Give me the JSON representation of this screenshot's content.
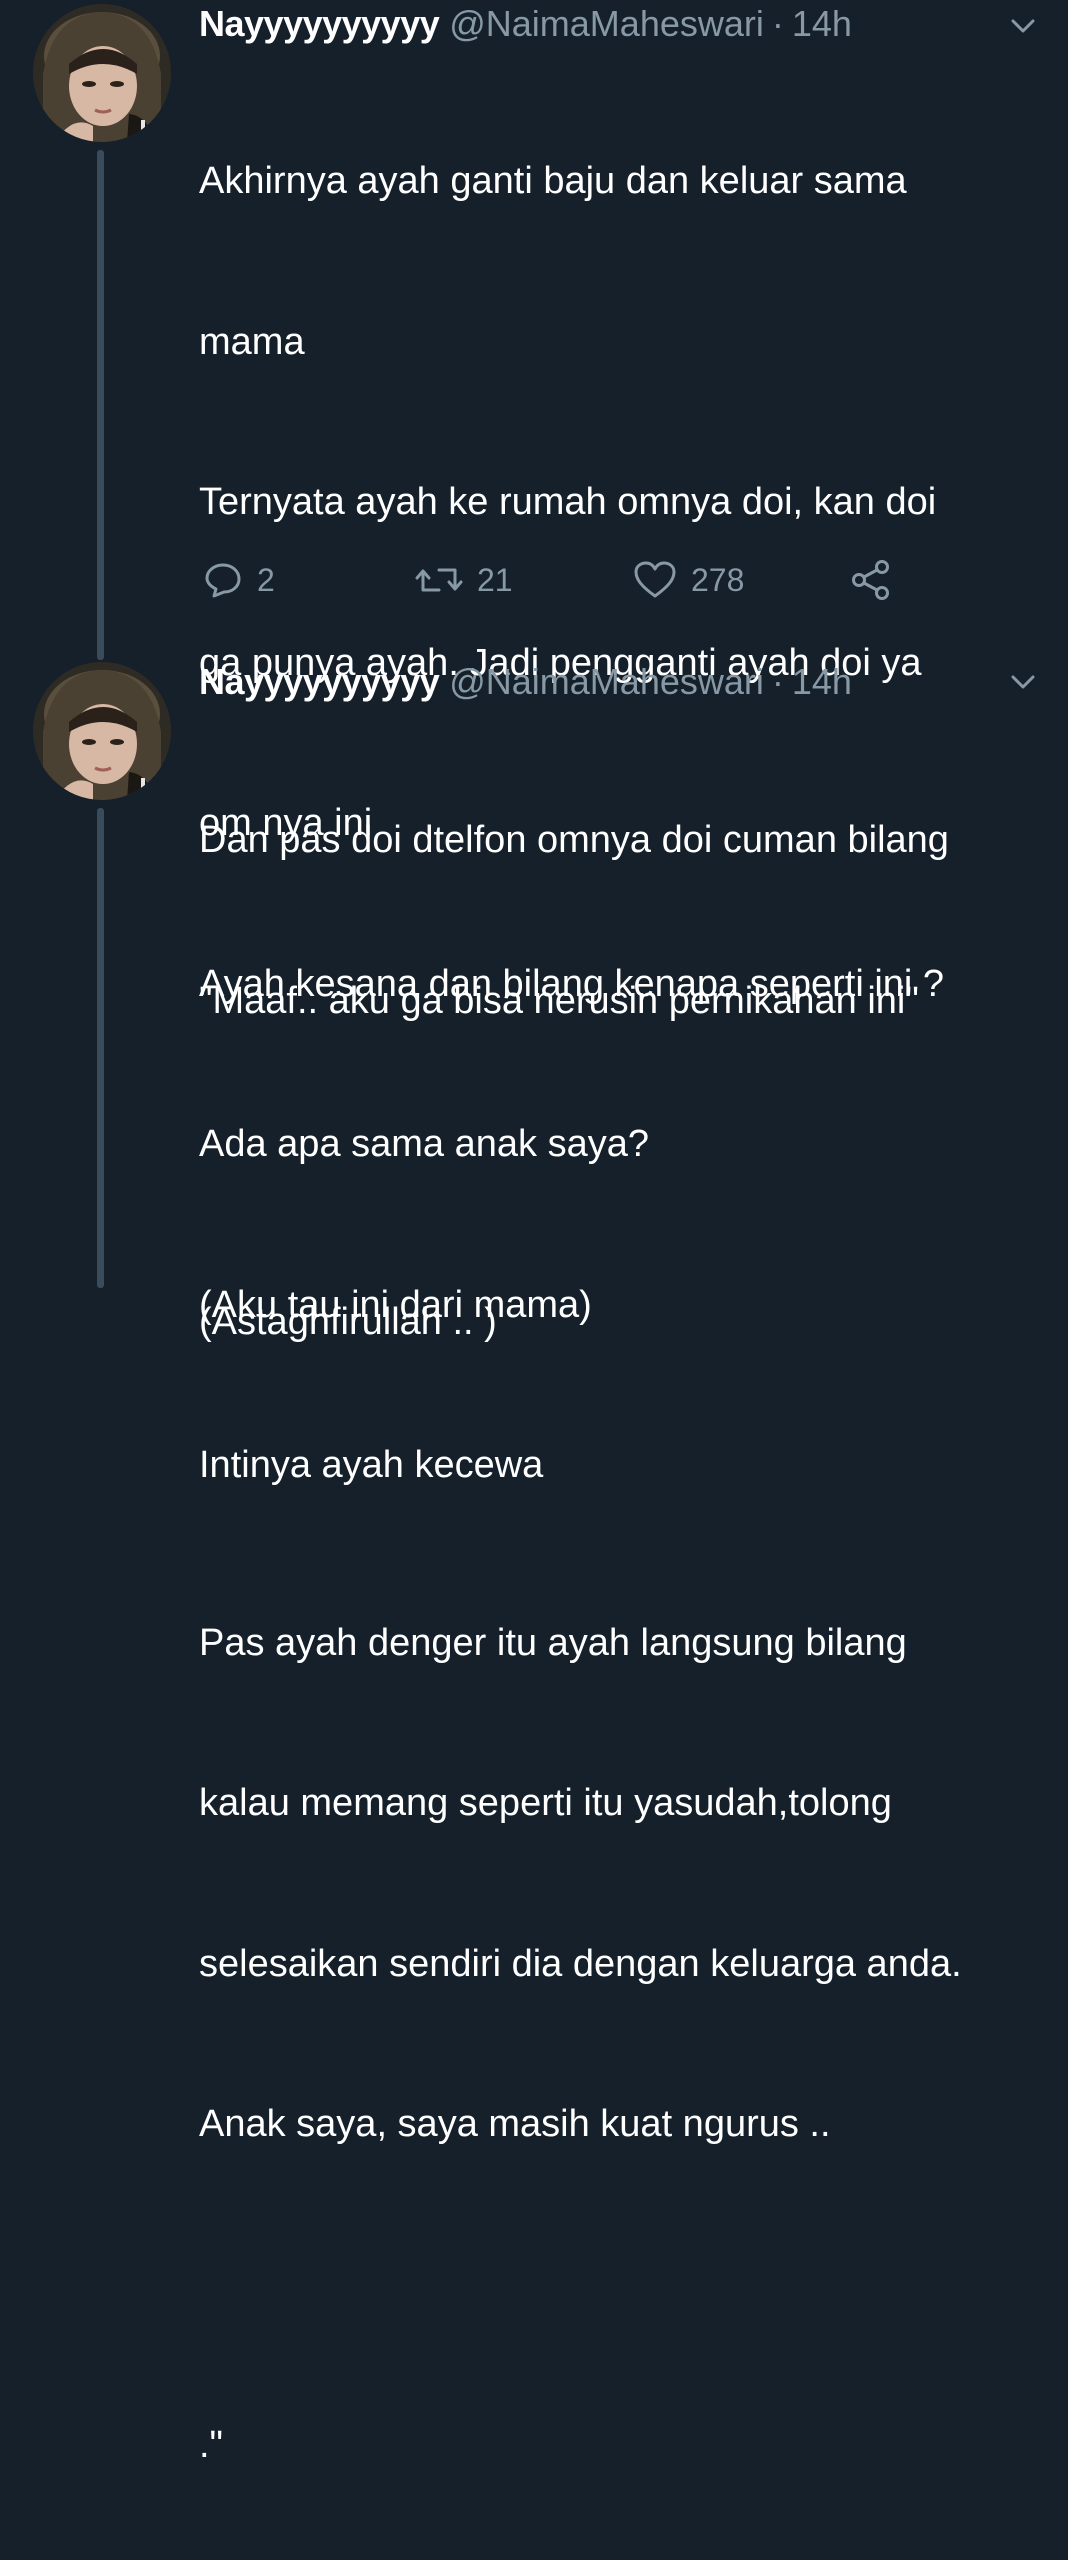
{
  "colors": {
    "background": "#15202b",
    "secondary_text": "#8899a6",
    "thread_line": "#3a4b5c"
  },
  "tweets": [
    {
      "display_name": "Nayyyyyyyyyy",
      "handle": "@NaimaMaheswari",
      "separator": "·",
      "time": "14h",
      "avatar_icon": "profile-photo",
      "lines": [
        "Akhirnya ayah ganti baju dan keluar sama",
        "mama",
        "Ternyata ayah ke rumah omnya doi, kan doi",
        "ga punya ayah. Jadi pengganti ayah doi ya",
        "om nya ini",
        "Ayah kesana dan bilang kenapa seperti ini ?",
        "Ada apa sama anak saya?",
        "(Aku tau ini dari mama)",
        "Intinya ayah kecewa"
      ],
      "actions": {
        "replies": "2",
        "retweets": "21",
        "likes": "278"
      }
    },
    {
      "display_name": "Nayyyyyyyyyy",
      "handle": "@NaimaMaheswari",
      "separator": "·",
      "time": "14h",
      "avatar_icon": "profile-photo",
      "lines": [
        "Dan pas doi dtelfon omnya doi cuman bilang",
        "\"Maaf.. aku ga bisa nerusin pernikahan ini\"",
        "",
        "(Astaghfirullah .. )",
        "",
        "Pas ayah denger itu ayah langsung bilang",
        "kalau memang seperti itu yasudah,tolong",
        "selesaikan sendiri dia dengan keluarga anda.",
        "Anak saya, saya masih kuat ngurus ..",
        "",
        ".\""
      ]
    }
  ]
}
